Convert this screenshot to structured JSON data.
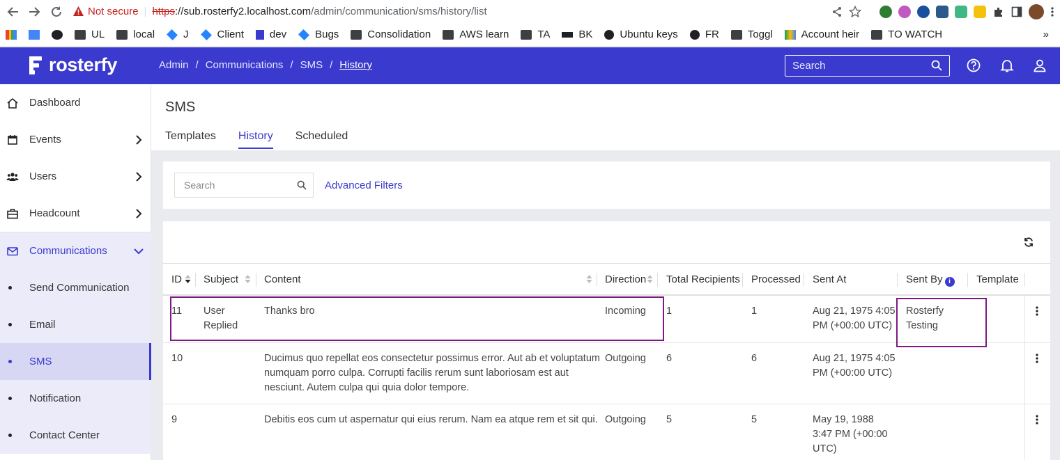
{
  "browser": {
    "url_warning": "Not secure",
    "url_scheme": "https",
    "url_host": "://sub.rosterfy2.localhost.com",
    "url_path": "/admin/communication/sms/history/list",
    "bookmarks": [
      {
        "label": "",
        "icon": "gmail-icon"
      },
      {
        "label": "",
        "icon": "calendar-icon"
      },
      {
        "label": "",
        "icon": "github-icon"
      },
      {
        "label": "UL",
        "icon": "folder-icon"
      },
      {
        "label": "local",
        "icon": "folder-icon"
      },
      {
        "label": "J",
        "icon": "jira-icon"
      },
      {
        "label": "Client",
        "icon": "jira-icon"
      },
      {
        "label": "dev",
        "icon": "rosterfy-icon"
      },
      {
        "label": "Bugs",
        "icon": "jira-icon"
      },
      {
        "label": "Consolidation",
        "icon": "folder-icon"
      },
      {
        "label": "AWS learn",
        "icon": "folder-icon"
      },
      {
        "label": "TA",
        "icon": "folder-icon"
      },
      {
        "label": "BK",
        "icon": "bk-icon"
      },
      {
        "label": "Ubuntu keys",
        "icon": "globe-icon"
      },
      {
        "label": "FR",
        "icon": "globe-icon"
      },
      {
        "label": "Toggl",
        "icon": "folder-icon"
      },
      {
        "label": "Account heir",
        "icon": "drive-icon"
      },
      {
        "label": "TO WATCH",
        "icon": "folder-icon"
      }
    ],
    "more": "»"
  },
  "header": {
    "brand": "rosterfy",
    "breadcrumb": [
      "Admin",
      "/",
      "Communications",
      "/",
      "SMS",
      "/",
      "History"
    ],
    "search_placeholder": "Search"
  },
  "sidebar": {
    "items": [
      {
        "label": "Dashboard"
      },
      {
        "label": "Events"
      },
      {
        "label": "Users"
      },
      {
        "label": "Headcount"
      },
      {
        "label": "Communications"
      },
      {
        "label": "Send Communication"
      },
      {
        "label": "Email"
      },
      {
        "label": "SMS"
      },
      {
        "label": "Notification"
      },
      {
        "label": "Contact Center"
      }
    ]
  },
  "page": {
    "title": "SMS",
    "tabs": [
      "Templates",
      "History",
      "Scheduled"
    ],
    "search_placeholder": "Search",
    "advanced_filters": "Advanced Filters"
  },
  "table": {
    "columns": [
      "ID",
      "Subject",
      "Content",
      "Direction",
      "Total Recipients",
      "Processed",
      "Sent At",
      "Sent By",
      "Template"
    ],
    "rows": [
      {
        "id": "11",
        "subject": [
          "User",
          "Replied"
        ],
        "content": [
          "Thanks bro"
        ],
        "direction": "Incoming",
        "total": "1",
        "processed": "1",
        "sent_at": [
          "Aug 21, 1975 4:05",
          "PM (+00:00 UTC)"
        ],
        "sent_by": [
          "Rosterfy",
          "Testing"
        ],
        "template": ""
      },
      {
        "id": "10",
        "subject": [
          "",
          ""
        ],
        "content": [
          "Ducimus quo repellat eos consectetur possimus error. Aut ab et voluptatum",
          "numquam porro culpa. Corrupti facilis rerum sunt laboriosam est aut",
          "nesciunt. Autem culpa qui quia dolor tempore."
        ],
        "direction": "Outgoing",
        "total": "6",
        "processed": "6",
        "sent_at": [
          "Aug 21, 1975 4:05",
          "PM (+00:00 UTC)"
        ],
        "sent_by": [
          "",
          ""
        ],
        "template": ""
      },
      {
        "id": "9",
        "subject": [
          "",
          ""
        ],
        "content": [
          "Debitis eos cum ut aspernatur qui eius rerum. Nam ea atque rem et sit qui."
        ],
        "direction": "Outgoing",
        "total": "5",
        "processed": "5",
        "sent_at": [
          "May 19, 1988",
          "3:47 PM (+00:00",
          "UTC)"
        ],
        "sent_by": [
          "",
          ""
        ],
        "template": ""
      }
    ]
  },
  "colors": {
    "brand": "#3a3acf",
    "highlight": "#7b1a83"
  }
}
